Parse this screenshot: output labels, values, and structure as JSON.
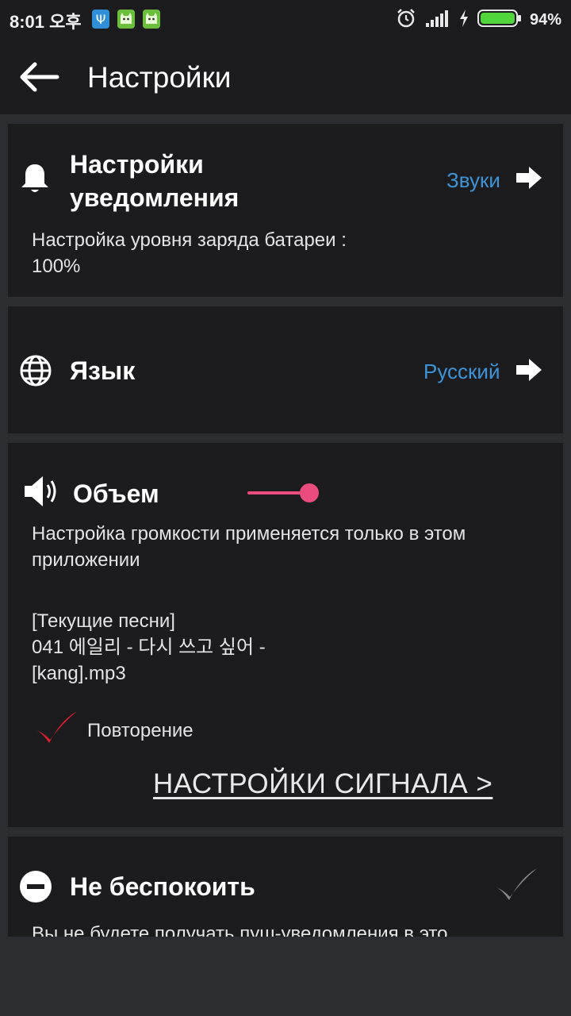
{
  "status_bar": {
    "time": "8:01 오후",
    "battery_percent": "94%",
    "battery_level": 0.94,
    "icons": [
      "psi-app-icon",
      "cat-app-icon",
      "cat-app-icon",
      "alarm-icon",
      "signal-icon",
      "charging-icon",
      "battery-icon"
    ]
  },
  "app_bar": {
    "title": "Настройки"
  },
  "notification_card": {
    "title": "Настройки уведомления",
    "subtitle": "Настройка уровня заряда батареи : 100%",
    "link": "Звуки"
  },
  "language_card": {
    "title": "Язык",
    "value": "Русский"
  },
  "volume_card": {
    "title": "Объем",
    "volume_level": 0.2,
    "description": "Настройка громкости применяется только в этом приложении",
    "current_song_label": "[Текущие песни]",
    "current_song_name": "041 에일리 - 다시 쓰고 싶어 - [kang].mp3",
    "repeat_label": "Повторение",
    "repeat_checked": true,
    "signal_settings_link": "НАСТРОЙКИ СИГНАЛА >"
  },
  "dnd_card": {
    "title": "Не беспокоить",
    "description": "Вы не будете получать пуш-уведомления в это",
    "enabled": false
  },
  "colors": {
    "accent_link": "#3d94d9",
    "slider_active": "#ea4c7e",
    "check_red": "#e0202e",
    "card_bg": "#1c1c1e",
    "page_bg": "#2b2d31"
  }
}
